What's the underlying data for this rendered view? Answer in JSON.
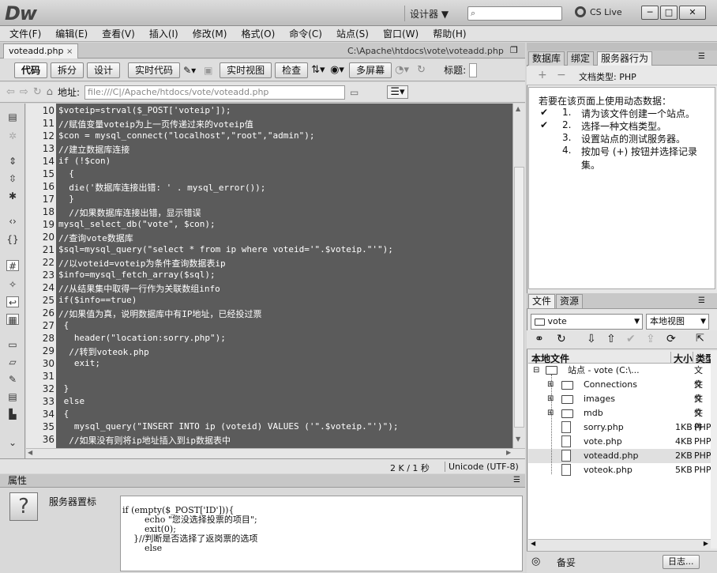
{
  "app": {
    "logo": "Dw",
    "layout_switcher": "设计器 ▼",
    "cs_live": "CS Live"
  },
  "window_controls": {
    "minimize": "─",
    "restore": "□",
    "close": "✕"
  },
  "menu": [
    "文件(F)",
    "编辑(E)",
    "查看(V)",
    "插入(I)",
    "修改(M)",
    "格式(O)",
    "命令(C)",
    "站点(S)",
    "窗口(W)",
    "帮助(H)"
  ],
  "document": {
    "tab": "voteadd.php",
    "path": "C:\\Apache\\htdocs\\vote\\voteadd.php"
  },
  "toolbar": {
    "code": "代码",
    "split": "拆分",
    "design": "设计",
    "live_code": "实时代码",
    "live_view": "实时视图",
    "inspect": "检查",
    "multiscreen": "多屏幕",
    "title_label": "标题:"
  },
  "address": {
    "label": "地址:",
    "value": "file:///C|/Apache/htdocs/vote/voteadd.php"
  },
  "code": {
    "line_numbers": [
      "10",
      "11",
      "12",
      "13",
      "14",
      "15",
      "16",
      "17",
      "18",
      "19",
      "20",
      "21",
      "22",
      "23",
      "24",
      "25",
      "26",
      "27",
      "28",
      "29",
      "30",
      "31",
      "32",
      "33",
      "34",
      "35",
      "36"
    ],
    "lines": [
      "$voteip=strval($_POST['voteip']);",
      "//赋值变量voteip为上一页传递过来的voteip值",
      "$con = mysql_connect(\"localhost\",\"root\",\"admin\");",
      "//建立数据库连接",
      "if (!$con)",
      "  {",
      "  die('数据库连接出错: ' . mysql_error());",
      "  }",
      "  //如果数据库连接出错，显示错误",
      "mysql_select_db(\"vote\", $con);",
      "//查询vote数据库",
      "$sql=mysql_query(\"select * from ip where voteid='\".$voteip.\"'\");",
      "//以voteid=voteip为条件查询数据表ip",
      "$info=mysql_fetch_array($sql);",
      "//从结果集中取得一行作为关联数组info",
      "if($info==true)",
      "//如果值为真，说明数据库中有IP地址，已经投过票",
      " {",
      "   header(\"location:sorry.php\");",
      "  //转到voteok.php",
      "   exit;",
      "",
      " }",
      " else",
      " {",
      "   mysql_query(\"INSERT INTO ip (voteid) VALUES ('\".$voteip.\"')\");",
      "  //如果没有则将ip地址插入到ip数据表中"
    ]
  },
  "status": {
    "size": "2 K / 1 秒",
    "encoding": "Unicode (UTF-8)"
  },
  "properties": {
    "title": "属性",
    "element_label": "服务器置标",
    "code_lines": [
      "if (empty($_POST['ID'])){",
      "        echo \"您没选择投票的项目\";",
      "        exit(0);",
      "    }//判断是否选择了返岗票的选项",
      "        else"
    ]
  },
  "server_panel": {
    "tabs": [
      "数据库",
      "绑定",
      "服务器行为"
    ],
    "doc_type": "文档类型: PHP",
    "intro": "若要在该页面上使用动态数据：",
    "steps": [
      {
        "num": "1.",
        "text": "请为该文件创建一个站点。",
        "checked": true
      },
      {
        "num": "2.",
        "text": "选择一种文档类型。",
        "checked": true
      },
      {
        "num": "3.",
        "text": "设置站点的测试服务器。",
        "checked": false
      },
      {
        "num": "4.",
        "text": "按加号 (+) 按钮并选择记录集。",
        "checked": false
      }
    ]
  },
  "files_panel": {
    "tabs": [
      "文件",
      "资源"
    ],
    "site_select": "vote",
    "view_select": "本地视图",
    "header": {
      "name": "本地文件",
      "size": "大小",
      "type": "类型"
    },
    "site_root": {
      "name": "站点 - vote (C:\\...",
      "type": "文件"
    },
    "items": [
      {
        "name": "Connections",
        "size": "",
        "type": "文件",
        "kind": "folder"
      },
      {
        "name": "images",
        "size": "",
        "type": "文件",
        "kind": "folder"
      },
      {
        "name": "mdb",
        "size": "",
        "type": "文件",
        "kind": "folder"
      },
      {
        "name": "sorry.php",
        "size": "1KB",
        "type": "PHP",
        "kind": "file"
      },
      {
        "name": "vote.php",
        "size": "4KB",
        "type": "PHP",
        "kind": "file"
      },
      {
        "name": "voteadd.php",
        "size": "2KB",
        "type": "PHP",
        "kind": "file"
      },
      {
        "name": "voteok.php",
        "size": "5KB",
        "type": "PHP",
        "kind": "file"
      }
    ],
    "status": "备妥",
    "log_button": "日志..."
  }
}
